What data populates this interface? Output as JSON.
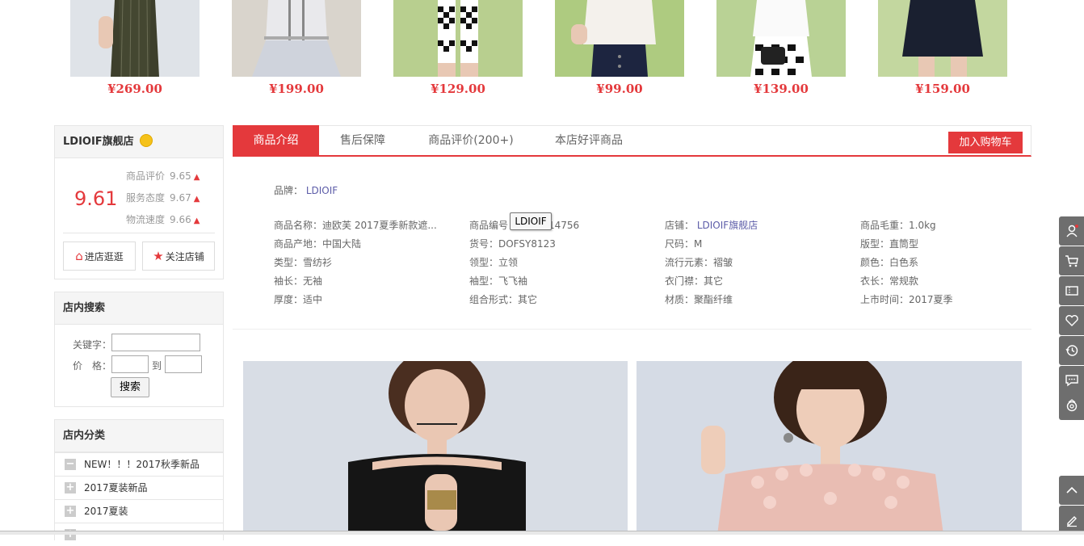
{
  "products": [
    {
      "price": "¥269.00"
    },
    {
      "price": "¥199.00"
    },
    {
      "price": "¥129.00"
    },
    {
      "price": "¥99.00"
    },
    {
      "price": "¥139.00"
    },
    {
      "price": "¥159.00"
    }
  ],
  "shop": {
    "name": "LDIOIF旗舰店",
    "score": "9.61",
    "ratings": [
      {
        "label": "商品评价",
        "value": "9.65"
      },
      {
        "label": "服务态度",
        "value": "9.67"
      },
      {
        "label": "物流速度",
        "value": "9.66"
      }
    ],
    "enter_label": "进店逛逛",
    "follow_label": "关注店铺"
  },
  "search": {
    "title": "店内搜索",
    "keyword_label": "关键字：",
    "price_label": "价　格：",
    "to_label": "到",
    "button_label": "搜索"
  },
  "categories": {
    "title": "店内分类",
    "items": [
      {
        "label": "NEW！！！2017秋季新品",
        "sign": "−"
      },
      {
        "label": "2017夏装新品",
        "sign": "+"
      },
      {
        "label": "2017夏装",
        "sign": "+"
      }
    ]
  },
  "tabs": {
    "items": [
      "商品介绍",
      "售后保障",
      "商品评价(200+)",
      "本店好评商品"
    ],
    "cart_label": "加入购物车"
  },
  "details": {
    "brand_label": "品牌：",
    "brand_value": "LDIOIF",
    "tooltip": "LDIOIF",
    "attrs": [
      [
        "商品名称：迪欧芙 2017夏季新款遮...",
        "商品编号",
        "店铺：",
        "商品毛重：1.0kg"
      ],
      [
        "商品产地：中国大陆",
        "货号：DOFSY8123",
        "尺码：M",
        "版型：直筒型"
      ],
      [
        "类型：雪纺衫",
        "领型：立领",
        "流行元素：褶皱",
        "颜色：白色系"
      ],
      [
        "袖长：无袖",
        "袖型：飞飞袖",
        "衣门襟：其它",
        "衣长：常规款"
      ],
      [
        "厚度：适中",
        "组合形式：其它",
        "材质：聚酯纤维",
        "上市时间：2017夏季"
      ]
    ],
    "code_suffix": "14756",
    "shop_link": "LDIOIF旗舰店"
  },
  "sidebar_icons": [
    "user-icon",
    "cart-icon",
    "coupon-icon",
    "heart-icon",
    "history-icon",
    "chat-icon",
    "service-icon",
    "back-to-top-icon",
    "feedback-icon"
  ],
  "colors": {
    "accent": "#e4393c",
    "sidebar": "#6e6e6e",
    "link": "#5c5ca8"
  }
}
